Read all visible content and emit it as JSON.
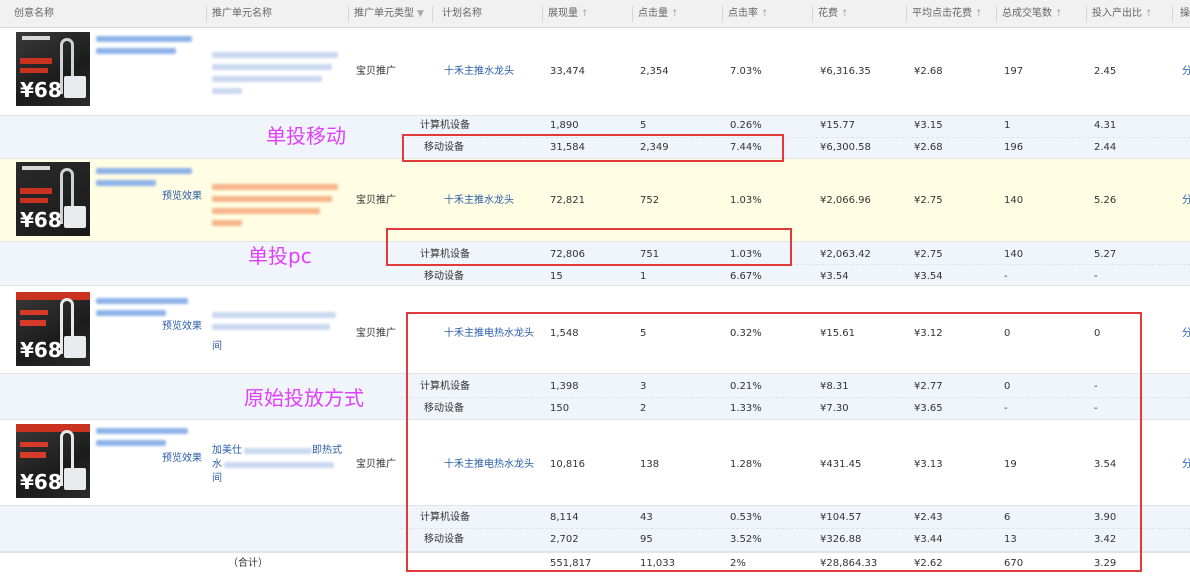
{
  "columns": {
    "creative_name": "创意名称",
    "unit_name": "推广单元名称",
    "unit_type": "推广单元类型",
    "plan_name": "计划名称",
    "impressions": "展现量",
    "clicks": "点击量",
    "ctr": "点击率",
    "cost": "花费",
    "avg_cpc": "平均点击花费",
    "total_deals": "总成交笔数",
    "roi": "投入产出比",
    "edge": "操"
  },
  "thumb_price": "¥68",
  "preview_label": "预览效果",
  "edge_link": "分",
  "rows": [
    {
      "unit_type": "宝贝推广",
      "plan": "十禾主推水龙头",
      "impressions": "33,474",
      "clicks": "2,354",
      "ctr": "7.03%",
      "cost": "¥6,316.35",
      "avg_cpc": "¥2.68",
      "deals": "197",
      "roi": "2.45",
      "devices": [
        {
          "device": "计算机设备",
          "impressions": "1,890",
          "clicks": "5",
          "ctr": "0.26%",
          "cost": "¥15.77",
          "avg_cpc": "¥3.15",
          "deals": "1",
          "roi": "4.31"
        },
        {
          "device": "移动设备",
          "impressions": "31,584",
          "clicks": "2,349",
          "ctr": "7.44%",
          "cost": "¥6,300.58",
          "avg_cpc": "¥2.68",
          "deals": "196",
          "roi": "2.44"
        }
      ]
    },
    {
      "unit_type": "宝贝推广",
      "plan": "十禾主推水龙头",
      "impressions": "72,821",
      "clicks": "752",
      "ctr": "1.03%",
      "cost": "¥2,066.96",
      "avg_cpc": "¥2.75",
      "deals": "140",
      "roi": "5.26",
      "devices": [
        {
          "device": "计算机设备",
          "impressions": "72,806",
          "clicks": "751",
          "ctr": "1.03%",
          "cost": "¥2,063.42",
          "avg_cpc": "¥2.75",
          "deals": "140",
          "roi": "5.27"
        },
        {
          "device": "移动设备",
          "impressions": "15",
          "clicks": "1",
          "ctr": "6.67%",
          "cost": "¥3.54",
          "avg_cpc": "¥3.54",
          "deals": "-",
          "roi": "-"
        }
      ]
    },
    {
      "unit_type": "宝贝推广",
      "plan": "十禾主推电热水龙头",
      "unit_name_tail": "间",
      "impressions": "1,548",
      "clicks": "5",
      "ctr": "0.32%",
      "cost": "¥15.61",
      "avg_cpc": "¥3.12",
      "deals": "0",
      "roi": "0",
      "devices": [
        {
          "device": "计算机设备",
          "impressions": "1,398",
          "clicks": "3",
          "ctr": "0.21%",
          "cost": "¥8.31",
          "avg_cpc": "¥2.77",
          "deals": "0",
          "roi": "-"
        },
        {
          "device": "移动设备",
          "impressions": "150",
          "clicks": "2",
          "ctr": "1.33%",
          "cost": "¥7.30",
          "avg_cpc": "¥3.65",
          "deals": "-",
          "roi": "-"
        }
      ]
    },
    {
      "unit_type": "宝贝推广",
      "plan": "十禾主推电热水龙头",
      "unit_name_lines": [
        "加美仕",
        "水",
        "间"
      ],
      "unit_name_suffix": "即热式",
      "impressions": "10,816",
      "clicks": "138",
      "ctr": "1.28%",
      "cost": "¥431.45",
      "avg_cpc": "¥3.13",
      "deals": "19",
      "roi": "3.54",
      "devices": [
        {
          "device": "计算机设备",
          "impressions": "8,114",
          "clicks": "43",
          "ctr": "0.53%",
          "cost": "¥104.57",
          "avg_cpc": "¥2.43",
          "deals": "6",
          "roi": "3.90"
        },
        {
          "device": "移动设备",
          "impressions": "2,702",
          "clicks": "95",
          "ctr": "3.52%",
          "cost": "¥326.88",
          "avg_cpc": "¥3.44",
          "deals": "13",
          "roi": "3.42"
        }
      ]
    }
  ],
  "total": {
    "label": "（合计）",
    "impressions": "551,817",
    "clicks": "11,033",
    "ctr": "2%",
    "cost": "¥28,864.33",
    "avg_cpc": "¥2.62",
    "deals": "670",
    "roi": "3.29"
  },
  "annotations": {
    "mobile_only": "单投移动",
    "pc_only": "单投pc",
    "original": "原始投放方式"
  },
  "colors": {
    "annotation": "#e040fb",
    "highlight_box": "#e13a3a",
    "link": "#2a5caa"
  }
}
